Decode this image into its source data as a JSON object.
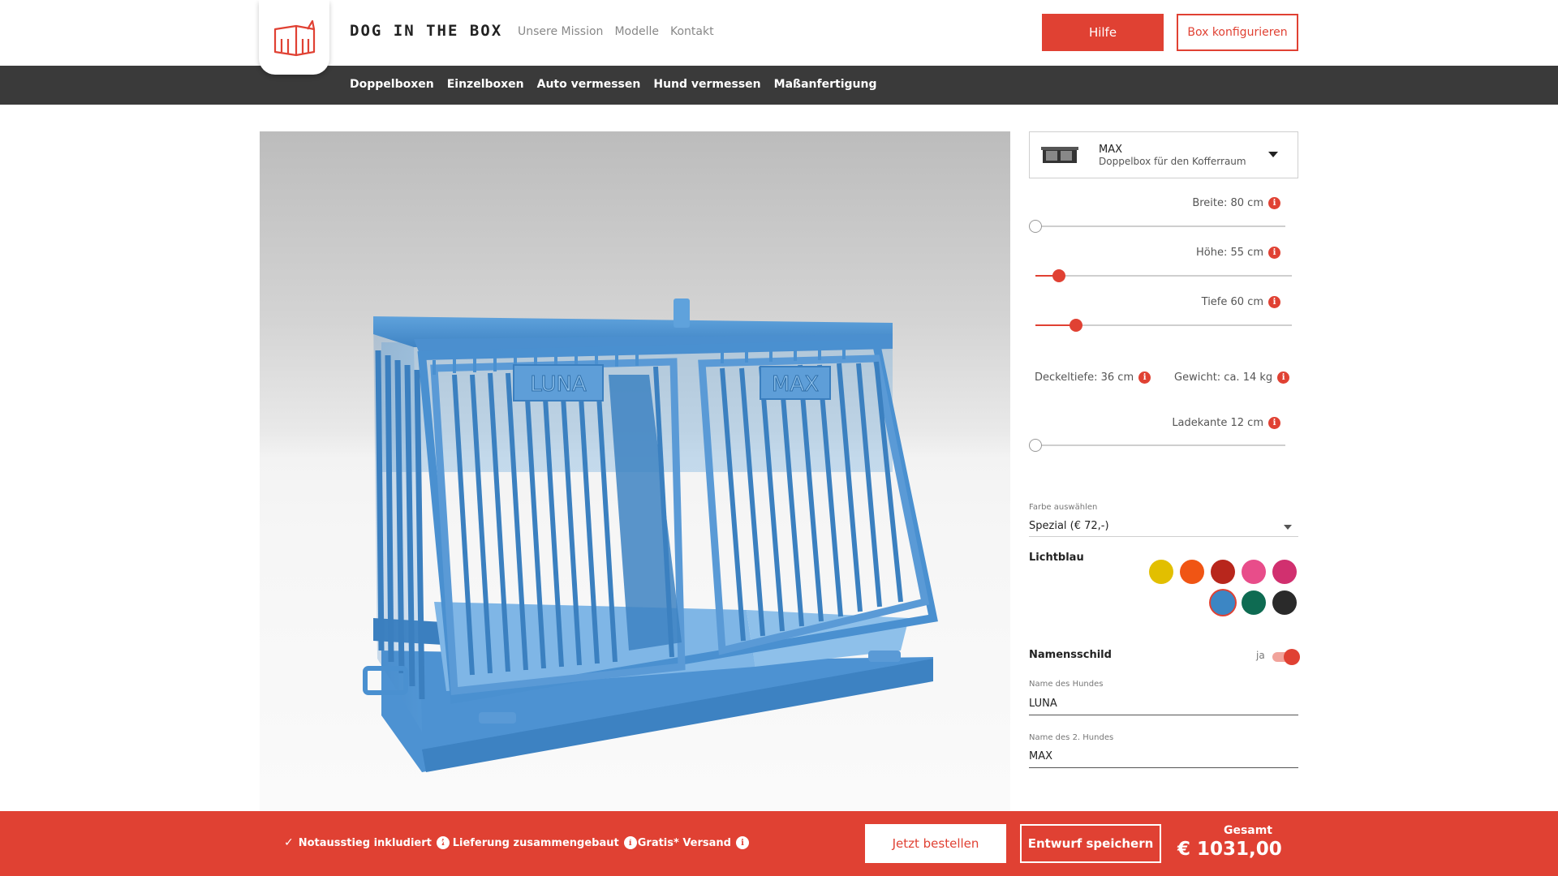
{
  "header": {
    "brand": "DOG IN THE BOX",
    "nav": [
      "Unsere Mission",
      "Modelle",
      "Kontakt"
    ],
    "help_label": "Hilfe",
    "configure_label": "Box konfigurieren"
  },
  "subnav": {
    "items": [
      "Doppelboxen",
      "Einzelboxen",
      "Auto vermessen",
      "Hund vermessen",
      "Maßanfertigung"
    ]
  },
  "viewer": {
    "nameplate_left": "LUNA",
    "nameplate_right": "MAX",
    "box_color": "#4a90d0"
  },
  "config": {
    "model": {
      "name": "MAX",
      "description": "Doppelbox für den Kofferraum"
    },
    "sliders": {
      "breite": {
        "label": "Breite: 80 cm",
        "value_fraction": 0.0
      },
      "hoehe": {
        "label": "Höhe: 55 cm",
        "value_fraction": 0.07
      },
      "tiefe": {
        "label": "Tiefe 60 cm",
        "value_fraction": 0.14
      },
      "ladekante": {
        "label": "Ladekante 12 cm",
        "value_fraction": 0.0
      }
    },
    "deckeltiefe": "Deckeltiefe: 36 cm",
    "gewicht": "Gewicht: ca. 14 kg",
    "color": {
      "label": "Farbe auswählen",
      "selected_option": "Spezial (€ 72,-)",
      "selected_name": "Lichtblau",
      "swatches": [
        "#e2bf00",
        "#f05514",
        "#b8261c",
        "#e84d8a",
        "#d1306f",
        "#3c86c4",
        "#0e6b52",
        "#2a2a2a"
      ],
      "selected_index": 5
    },
    "nameplate": {
      "label": "Namensschild",
      "toggle_text": "ja",
      "toggle_on": true,
      "dog1_label": "Name des Hundes",
      "dog1_value": "LUNA",
      "dog2_label": "Name des 2. Hundes",
      "dog2_value": "MAX"
    }
  },
  "footer": {
    "features": [
      "Notausstieg inkludiert",
      "Lieferung zusammengebaut",
      "Gratis* Versand"
    ],
    "order_label": "Jetzt bestellen",
    "save_label": "Entwurf speichern",
    "total_label": "Gesamt",
    "total_value": "€ 1031,00"
  },
  "colors": {
    "accent": "#e04133",
    "dark_bar": "#3a3a3a"
  }
}
